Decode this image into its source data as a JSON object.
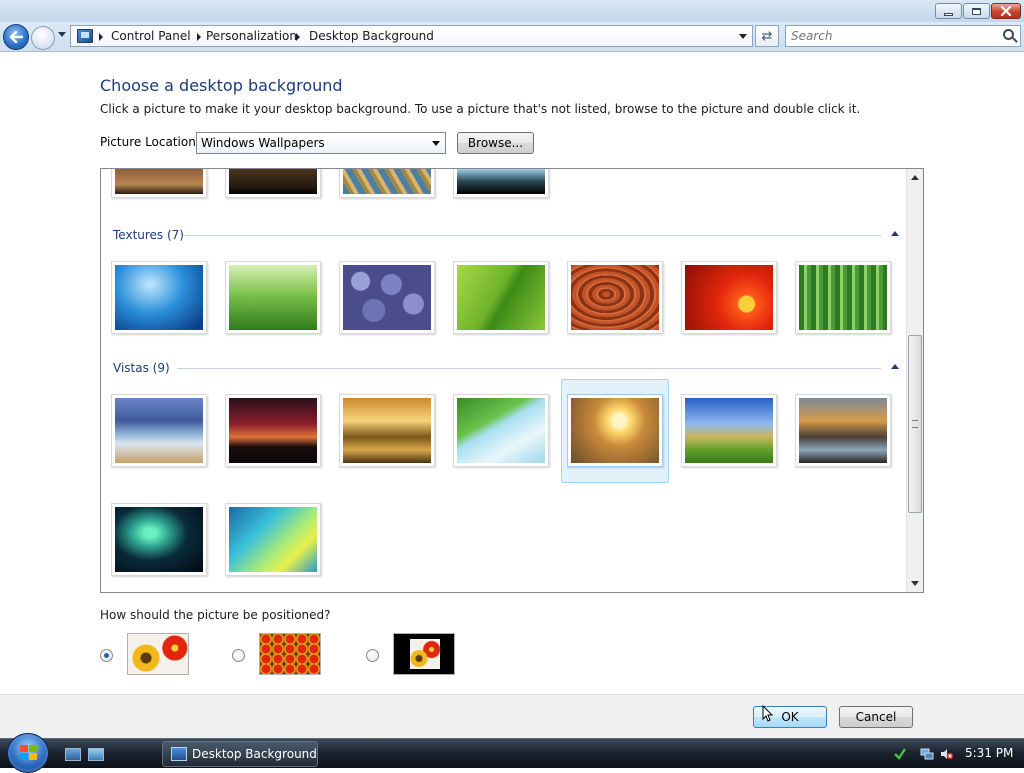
{
  "window": {
    "caption_buttons": [
      "minimize",
      "maximize",
      "close"
    ]
  },
  "address_bar": {
    "crumbs": [
      "Control Panel",
      "Personalization",
      "Desktop Background"
    ],
    "search_placeholder": "Search"
  },
  "content": {
    "title": "Choose a desktop background",
    "description": "Click a picture to make it your desktop background. To use a picture that's not listed, browse to the picture and double click it.",
    "picture_location_label": "Picture Location",
    "picture_location_value": "Windows Wallpapers",
    "browse_label": "Browse...",
    "groups": [
      {
        "title": "Textures (7)",
        "images": [
          "underwater-fish",
          "green-grass",
          "blue-pebbles",
          "green-leaf",
          "wood-grain",
          "red-flower",
          "bamboo"
        ]
      },
      {
        "title": "Vistas (9)",
        "images": [
          "mountain-lake",
          "red-sunset",
          "golden-rocks",
          "palm-frond",
          "sunset-field",
          "green-hills",
          "canyon-pool",
          "aurora",
          "vista-swirl"
        ],
        "selected_index": 4
      }
    ],
    "top_row_images": [
      "art-scene",
      "temple",
      "abstract-blue",
      "lizard"
    ],
    "position_question": "How should the picture be positioned?",
    "position_options": [
      "fit-to-screen",
      "tile",
      "center"
    ],
    "position_selected": 0
  },
  "footer": {
    "ok_label": "OK",
    "cancel_label": "Cancel"
  },
  "taskbar": {
    "task_label": "Desktop Background",
    "clock": "5:31 PM",
    "tray_icons": [
      "network-icon",
      "volume-muted-icon",
      "security-check-icon"
    ]
  },
  "colors": {
    "link_blue": "#1e3c78",
    "selection_bg": "#e3f1fb",
    "taskbar": "#1c2530"
  }
}
